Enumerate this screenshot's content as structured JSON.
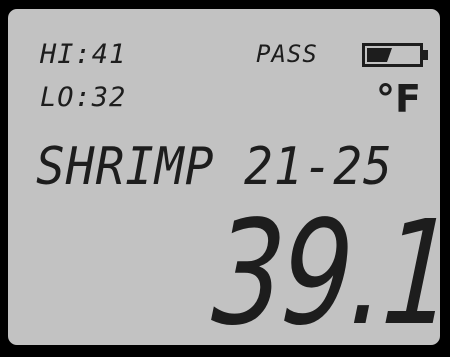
{
  "display": {
    "hi_reading": "HI:41",
    "lo_reading": "LO:32",
    "status": "PASS",
    "unit": "°F",
    "product_name": "SHRIMP 21-25",
    "temperature": "39.1"
  },
  "battery": {
    "icon": "battery-icon",
    "charge_level": 0.5
  },
  "colors": {
    "screen": "#c2c2c2",
    "segment": "#1d1d1d",
    "bezel": "#000000"
  }
}
